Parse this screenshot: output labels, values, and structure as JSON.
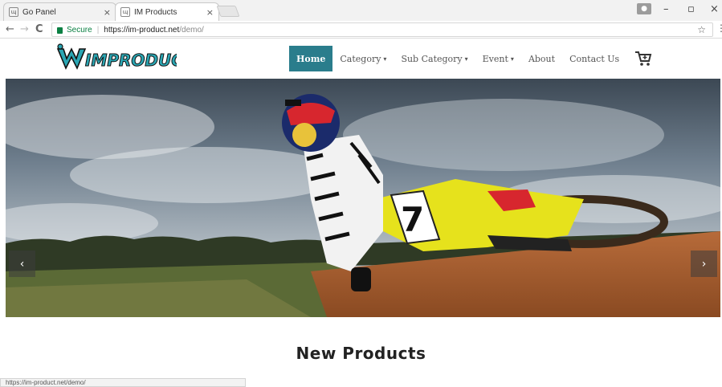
{
  "browser": {
    "tabs": [
      {
        "label": "Go Panel",
        "close": "×",
        "favicon": "ɰ"
      },
      {
        "label": "IM Products",
        "close": "×",
        "favicon": "ɰ"
      }
    ],
    "window": {
      "minimize": "–",
      "restore": "▫",
      "close": "×"
    },
    "nav": {
      "back": "←",
      "forward": "→",
      "reload": "C"
    },
    "secure_label": "Secure",
    "url_scheme_host": "https://im-product.net",
    "url_path": "/demo/",
    "bookmark_icon": "☆",
    "menu_icon": "⋮",
    "status_url": "https://im-product.net/demo/"
  },
  "site": {
    "logo_text": "IMPRODUCT",
    "nav": {
      "home": "Home",
      "category": "Category",
      "sub_category": "Sub Category",
      "event": "Event",
      "about": "About",
      "contact": "Contact Us"
    },
    "caret": "▾",
    "hero": {
      "prev": "‹",
      "next": "›",
      "bike_number": "7"
    },
    "section_title": "New Products"
  },
  "colors": {
    "accent": "#2a7d8c",
    "logo_teal": "#2aa6b3"
  }
}
